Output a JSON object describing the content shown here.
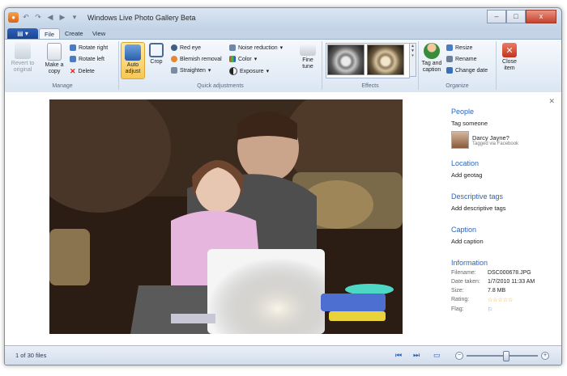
{
  "window": {
    "title": "Windows Live Photo Gallery Beta",
    "controls": {
      "minimize": "–",
      "maximize": "□",
      "close": "x"
    }
  },
  "tabs": {
    "file": "File",
    "create": "Create",
    "view": "View"
  },
  "ribbon": {
    "manage": {
      "label": "Manage",
      "revert": "Revert to original",
      "make_copy": "Make a copy",
      "rotate_right": "Rotate right",
      "rotate_left": "Rotate left",
      "delete": "Delete"
    },
    "quick": {
      "label": "Quick adjustments",
      "auto_adjust": "Auto adjust",
      "crop": "Crop",
      "red_eye": "Red eye",
      "blemish": "Blemish removal",
      "straighten": "Straighten",
      "noise": "Noise reduction",
      "color": "Color",
      "exposure": "Exposure",
      "fine_tune": "Fine tune"
    },
    "effects": {
      "label": "Effects"
    },
    "organize": {
      "label": "Organize",
      "tag_caption": "Tag and caption",
      "resize": "Resize",
      "rename": "Rename",
      "change_date": "Change date"
    },
    "close_item": "Close item"
  },
  "panel": {
    "people": {
      "title": "People",
      "action": "Tag someone",
      "person_name": "Darcy Jayne?",
      "person_sub": "Tagged via Facebook"
    },
    "location": {
      "title": "Location",
      "action": "Add geotag"
    },
    "descriptive": {
      "title": "Descriptive tags",
      "action": "Add descriptive tags"
    },
    "caption": {
      "title": "Caption",
      "action": "Add caption"
    },
    "information": {
      "title": "Information",
      "filename_k": "Filename:",
      "filename_v": "DSC000678.JPG",
      "date_k": "Date taken:",
      "date_v": "1/7/2010 11:33 AM",
      "size_k": "Size:",
      "size_v": "7.8 MB",
      "rating_k": "Rating:",
      "rating_v": "☆☆☆☆☆",
      "flag_k": "Flag:",
      "flag_v": "⚐"
    }
  },
  "status": {
    "count": "1 of 30 files",
    "zoom_level": 0.55
  }
}
